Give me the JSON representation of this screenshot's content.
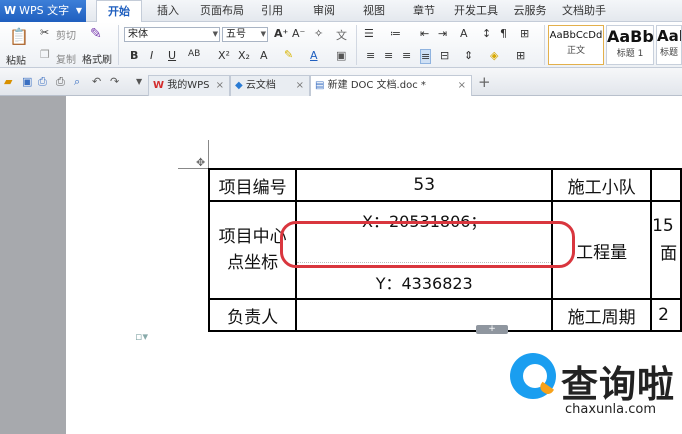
{
  "app": {
    "name": "WPS 文字",
    "logo": "W"
  },
  "menu_tabs": [
    "开始",
    "插入",
    "页面布局",
    "引用",
    "审阅",
    "视图",
    "章节",
    "开发工具",
    "云服务",
    "文档助手"
  ],
  "ribbon": {
    "paste": "粘贴",
    "cut": "剪切",
    "copy": "复制",
    "format_painter": "格式刷",
    "font_name": "宋体",
    "font_size": "五号",
    "styles": [
      {
        "sample": "AaBbCcDd",
        "name": "正文"
      },
      {
        "sample": "AaBb",
        "name": "标题 1"
      },
      {
        "sample": "AaB",
        "name": "标题"
      }
    ]
  },
  "doc_tabs": [
    {
      "label": "我的WPS",
      "icon": "wps-icon"
    },
    {
      "label": "云文档",
      "icon": "cloud-box-icon"
    },
    {
      "label": "新建 DOC 文档.doc *",
      "icon": "doc-file-icon",
      "active": true
    }
  ],
  "table": {
    "r1": {
      "label": "项目编号",
      "value": "53",
      "label2": "施工小队"
    },
    "r2": {
      "label": "项目中心点坐标",
      "x": "X：20531806；",
      "y": "Y：4336823",
      "label2": "工程量",
      "partial": "15",
      "partial2": "面"
    },
    "r3": {
      "label": "负责人",
      "label2": "施工周期",
      "partial": "2"
    }
  },
  "watermark": {
    "title": "查询啦",
    "sub": "chaxunla.com"
  },
  "colors": {
    "accent": "#1f5fbf",
    "highlight": "#d9363e"
  }
}
